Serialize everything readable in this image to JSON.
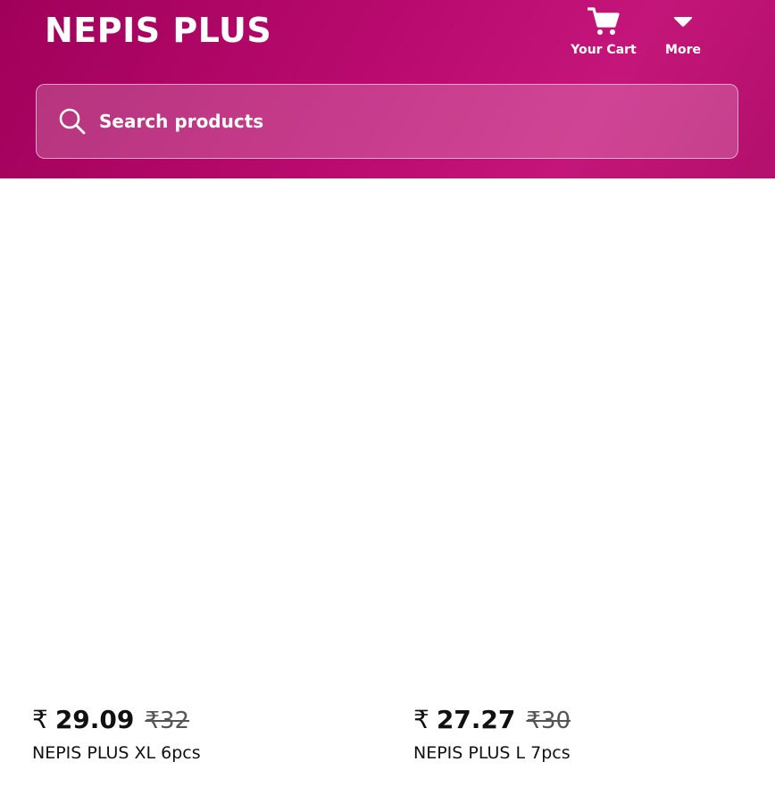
{
  "header": {
    "brand": "NEPIS PLUS",
    "nav": {
      "cart_label": "Your Cart",
      "more_label": "More"
    }
  },
  "search": {
    "placeholder": "Search products",
    "value": ""
  },
  "products": [
    {
      "currency_symbol": "₹",
      "price": "29.09",
      "mrp": "₹32",
      "name": "NEPIS PLUS XL 6pcs"
    },
    {
      "currency_symbol": "₹",
      "price": "27.27",
      "mrp": "₹30",
      "name": "NEPIS PLUS L 7pcs"
    }
  ],
  "icons": {
    "cart": "cart-icon",
    "more": "chevron-down-icon",
    "search": "search-icon"
  },
  "colors": {
    "header_gradient_start": "#a0005a",
    "header_gradient_end": "#c4167a",
    "text_on_header": "#ffffff",
    "price_text": "#111111",
    "mrp_text": "#555555"
  }
}
